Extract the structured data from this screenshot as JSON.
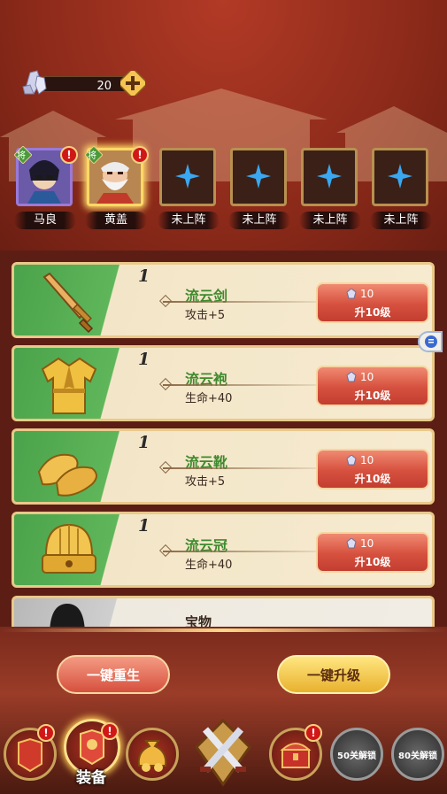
{
  "resource": {
    "amount": "20",
    "icon": "crystal-icon",
    "add_icon": "plus-icon"
  },
  "heroes": [
    {
      "name": "马良",
      "state": "filled",
      "has_alert": true,
      "alert_mark": "!",
      "tag": "将",
      "selected": false
    },
    {
      "name": "黄盖",
      "state": "filled",
      "has_alert": true,
      "alert_mark": "!",
      "tag": "将",
      "selected": true
    },
    {
      "name": "未上阵",
      "state": "empty"
    },
    {
      "name": "未上阵",
      "state": "empty"
    },
    {
      "name": "未上阵",
      "state": "empty"
    },
    {
      "name": "未上阵",
      "state": "empty"
    }
  ],
  "equipment": [
    {
      "level": "1",
      "name": "流云剑",
      "stat": "攻击+5",
      "icon": "sword-icon",
      "cost": "10",
      "button": "升10级"
    },
    {
      "level": "1",
      "name": "流云袍",
      "stat": "生命+40",
      "icon": "robe-icon",
      "cost": "10",
      "button": "升10级"
    },
    {
      "level": "1",
      "name": "流云靴",
      "stat": "攻击+5",
      "icon": "boots-icon",
      "cost": "10",
      "button": "升10级"
    },
    {
      "level": "1",
      "name": "流云冠",
      "stat": "生命+40",
      "icon": "crown-icon",
      "cost": "10",
      "button": "升10级"
    }
  ],
  "partial_card": {
    "name": "宝物"
  },
  "actions": {
    "rebirth": "一键重生",
    "upgrade_all": "一键升级"
  },
  "nav": [
    {
      "icon": "armor-icon",
      "has_alert": true
    },
    {
      "icon": "equipment-icon",
      "label": "装备",
      "has_alert": true,
      "active": true
    },
    {
      "icon": "gold-bag-icon"
    },
    {
      "icon": "crossed-swords-icon"
    },
    {
      "icon": "treasure-chest-icon",
      "has_alert": true
    },
    {
      "icon": "locked-icon",
      "lock_text": "50关解锁"
    },
    {
      "icon": "locked-icon",
      "lock_text": "80关解锁"
    }
  ],
  "colors": {
    "accent_green": "#5fb65a",
    "equip_name_green": "#3e8a2e",
    "upgrade_red": "#d6503e",
    "gold": "#e8b12e",
    "alert_red": "#d01818"
  }
}
